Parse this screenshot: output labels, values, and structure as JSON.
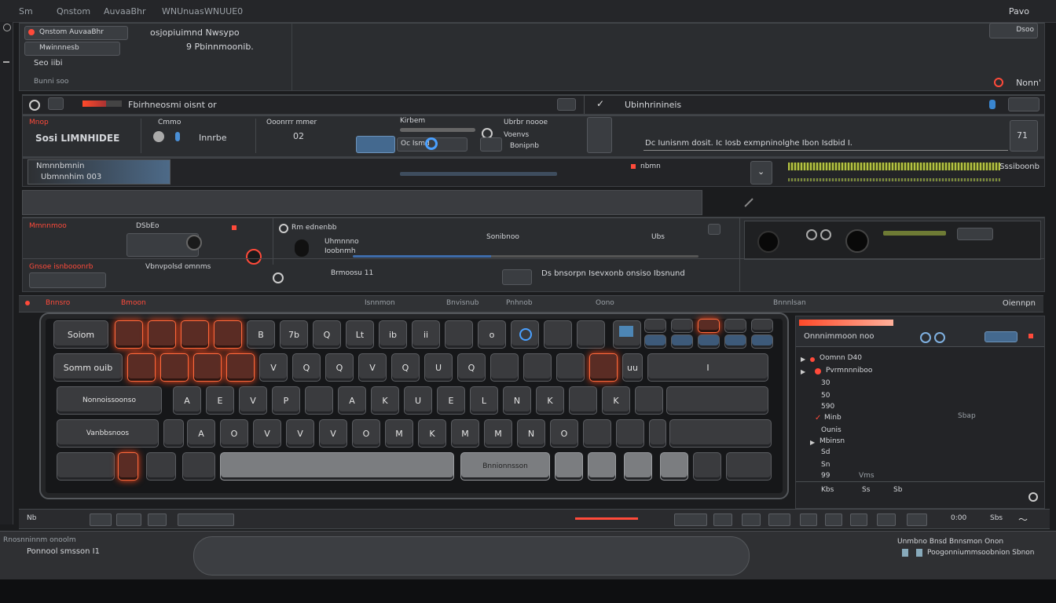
{
  "menu": {
    "items": [
      "Sm",
      "Qnstom",
      "AuvaaBhr",
      "WNUnuas",
      "WNUUE0"
    ],
    "right": "Pavo"
  },
  "top": {
    "project": "Qnstom AuvaaBhr",
    "subtitle": "osjopiuimnd Nwsypo",
    "file_label": "Mwinnnesb",
    "id_text": "9 Pbinnmoonib.",
    "meta": "Bunni soo",
    "tag": "Seo iibi",
    "right_label": "Dsoo",
    "status": "Nonn'"
  },
  "secondary": {
    "left_title": "Fbirhneosmi oisnt or",
    "right_title": "Ubinhrinineis",
    "channel_label": "Mnop",
    "channel_name": "Sosi LIMNHIDEE",
    "channel_sub": "Innrbe",
    "opt1": "Cmmo",
    "opt2": "Ooonrrr mmer",
    "opt3": "Kirbem",
    "opt4": "Oc Ismd",
    "opt5": "Ubrbr noooe",
    "opt6": "Voenvs",
    "opt7": "Bonipnb",
    "desc": "Dc Iunisnm dosit. Ic Iosb exmpninolghe Ibon Isdbid I.",
    "n1": "71",
    "n2": "02"
  },
  "third": {
    "a": "Nmnnbmnin",
    "b": "Ubmnnhim 003",
    "c": "nbmn",
    "d": "Sssiboonb"
  },
  "fourth": {
    "a": "Mmnnmoo",
    "b": "Rm ednenbb",
    "c": "DSbEo",
    "d": "Gnsoe isnbooonrb",
    "e": "Uhmnnno",
    "f": "Ioobnmh",
    "g": "Sonibnoo",
    "h": "Vbnvpolsd omnms",
    "i": "Brmoosu 11",
    "j": "Ds bnsorpn Isevxonb onsiso Ibsnund",
    "k": "Ubs"
  },
  "keyboard": {
    "header_labels": [
      "Bnnsro",
      "Bmoon",
      "Isnnmon",
      "Bnvisnub",
      "Pnhnob",
      "Oono",
      "Bnnnlsan"
    ],
    "right_label": "Oiennpn",
    "row1": [
      "Soiom",
      "",
      "",
      "",
      "",
      "B",
      "7b",
      "Q",
      "Lt",
      "ib",
      "ii",
      "",
      "o",
      "",
      "",
      ""
    ],
    "row2": [
      "Somm ouib",
      "",
      "",
      "",
      "",
      "V",
      "Q",
      "Q",
      "V",
      "Q",
      "U",
      "Q",
      "",
      "",
      "",
      "uu",
      "I"
    ],
    "row3": [
      "Nonnoissoonso",
      "A",
      "E",
      "V",
      "P",
      "",
      "A",
      "K",
      "U",
      "E",
      "L",
      "N",
      "K",
      "",
      "K",
      "",
      ""
    ],
    "row4": [
      "Vanbbsnoos",
      "A",
      "O",
      "V",
      "V",
      "V",
      "O",
      "M",
      "K",
      "M",
      "M",
      "N",
      "O",
      "",
      "",
      "",
      ""
    ],
    "row5": [
      "",
      "",
      "",
      "Bnnionnsson",
      "",
      "",
      ""
    ]
  },
  "sidebar": {
    "title": "Onnnimmoon noo",
    "items": [
      {
        "label": "Oomnn D40",
        "value": ""
      },
      {
        "label": "Pvrmnnniboo",
        "value": ""
      },
      {
        "label": "30",
        "value": ""
      },
      {
        "label": "50",
        "value": ""
      },
      {
        "label": "590",
        "value": ""
      },
      {
        "label": "Minb",
        "value": "Sbap"
      },
      {
        "label": "Ounis",
        "value": ""
      },
      {
        "label": "Mbinsn",
        "value": ""
      },
      {
        "label": "Sd",
        "value": ""
      },
      {
        "label": "Sn",
        "value": ""
      },
      {
        "label": "99",
        "value": "Vms"
      }
    ],
    "bottom": [
      "Kbs",
      "Ss",
      "Sb"
    ]
  },
  "status": {
    "left": "Nb",
    "time": "0:00",
    "right_btn": "Sbs"
  },
  "footer": {
    "left_top": "Rnosnninnm onoolm",
    "left_bottom": "Ponnool smsson I1",
    "right_top": "Unmbno Bnsd Bnnsmon Onon",
    "right_bottom": "Poogonniummsoobnion Sbnon"
  },
  "colors": {
    "accent": "#ff4a2a",
    "blue": "#4d80b8",
    "bg": "#1b1c1e"
  }
}
